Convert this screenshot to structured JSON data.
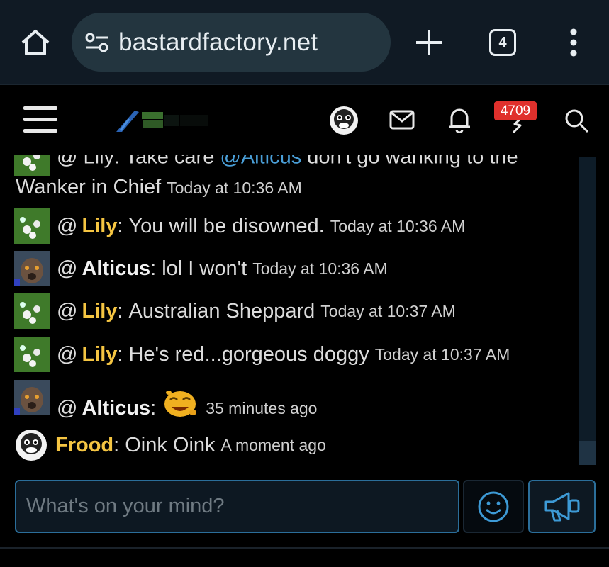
{
  "browser": {
    "url": "bastardfactory.net",
    "tab_count": "4"
  },
  "header": {
    "notification_count": "4709"
  },
  "chat": {
    "partial_message": {
      "prefix": "@ Lily: Take care ",
      "mention": "@Alticus",
      "suffix": " don't go wanking to the",
      "continuation": "Wanker in Chief",
      "time": "Today at 10:36 AM"
    },
    "messages": [
      {
        "at": "@",
        "user": "Lily",
        "text": "You will be disowned.",
        "time": "Today at 10:36 AM"
      },
      {
        "at": "@",
        "user": "Alticus",
        "text": "lol I won't",
        "time": "Today at 10:36 AM"
      },
      {
        "at": "@",
        "user": "Lily",
        "text": "Australian Sheppard",
        "time": "Today at 10:37 AM"
      },
      {
        "at": "@",
        "user": "Lily",
        "text": "He's red...gorgeous doggy",
        "time": "Today at 10:37 AM"
      },
      {
        "at": "@",
        "user": "Alticus",
        "text": "",
        "time": "35 minutes ago"
      },
      {
        "at": "",
        "user": "Frood",
        "text": "Oink Oink",
        "time": "A moment ago"
      }
    ]
  },
  "composer": {
    "placeholder": "What's on your mind?"
  },
  "colors": {
    "username_highlight": "#f5c542",
    "accent_border": "#2b6e9a",
    "badge_red": "#e0302c",
    "mention_blue": "#4a9fd8"
  }
}
